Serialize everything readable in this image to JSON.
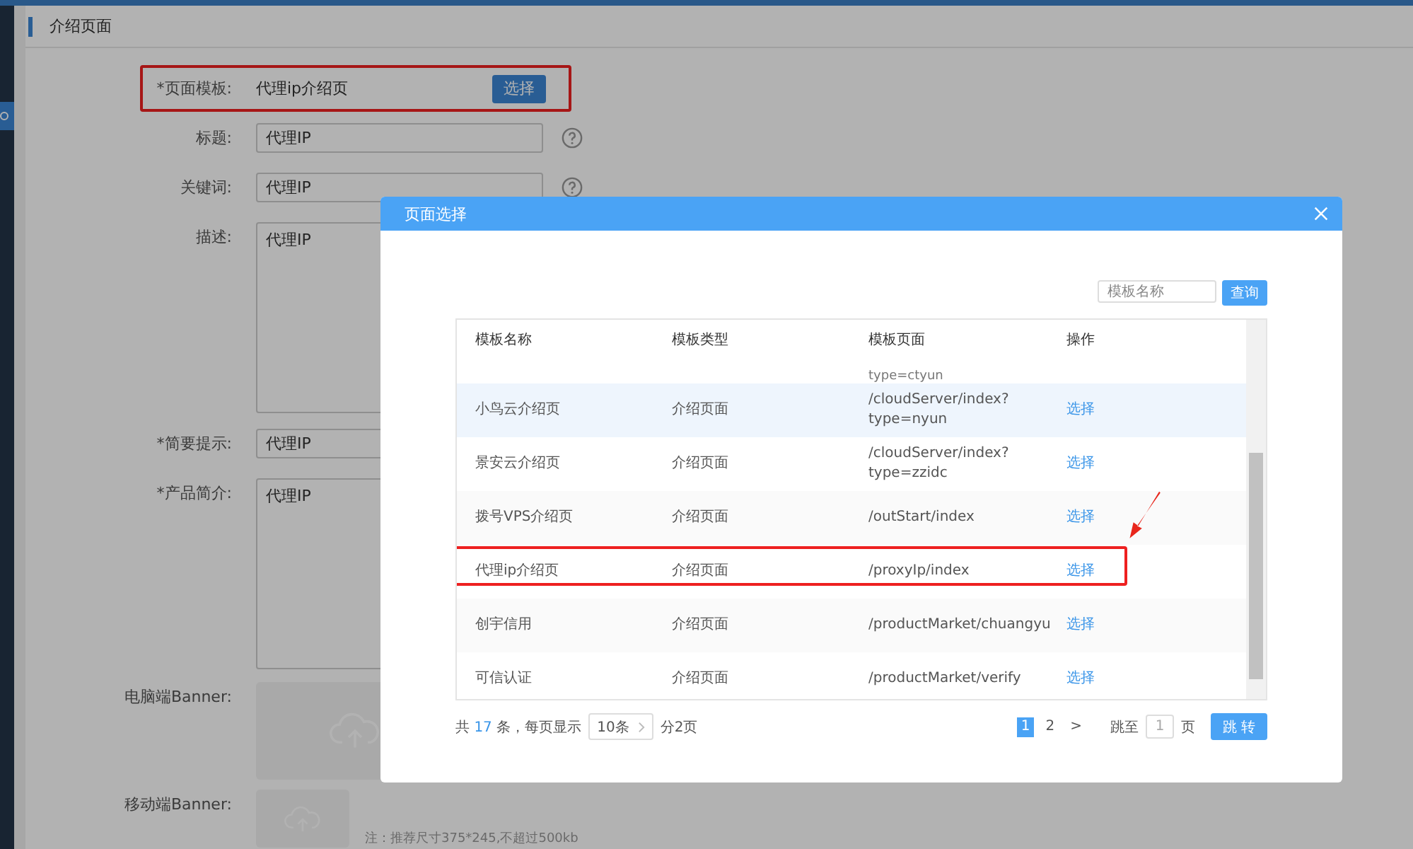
{
  "page": {
    "title": "介绍页面"
  },
  "form": {
    "fields": [
      {
        "kind": "static",
        "label": "*页面模板:",
        "annotated": true,
        "value": "代理ip介绍页",
        "button": "选择"
      },
      {
        "kind": "input",
        "label": "标题:",
        "help": true,
        "value": "代理IP"
      },
      {
        "kind": "input",
        "label": "关键词:",
        "help": true,
        "value": "代理IP"
      },
      {
        "kind": "textarea",
        "label": "描述:",
        "value": "代理IP"
      },
      {
        "kind": "input",
        "label": "*简要提示:",
        "help": false,
        "value": "代理IP"
      },
      {
        "kind": "textarea",
        "label": "*产品简介:",
        "value": "代理IP"
      },
      {
        "kind": "banner",
        "label": "电脑端Banner:"
      },
      {
        "kind": "thumb",
        "label": "移动端Banner:",
        "note": "注：推荐尺寸375*245,不超过500kb"
      }
    ]
  },
  "modal": {
    "title": "页面选择",
    "search": {
      "placeholder": "模板名称"
    },
    "search_button": "查询",
    "columns": [
      "模板名称",
      "模板类型",
      "模板页面",
      "操作"
    ],
    "rows": [
      {
        "kind": "cut",
        "page": "type=ctyun"
      },
      {
        "kind": "row",
        "name": "小鸟云介绍页",
        "type": "介绍页面",
        "page": "/cloudServer/index?\ntype=nyun",
        "action": "选择",
        "hovered": true,
        "annotated": false
      },
      {
        "kind": "row",
        "name": "景安云介绍页",
        "type": "介绍页面",
        "page": "/cloudServer/index?\ntype=zzidc",
        "action": "选择",
        "hovered": false,
        "annotated": false
      },
      {
        "kind": "row",
        "name": "拨号VPS介绍页",
        "type": "介绍页面",
        "page": "/outStart/index",
        "action": "选择",
        "hovered": false,
        "annotated": false
      },
      {
        "kind": "row",
        "name": "代理ip介绍页",
        "type": "介绍页面",
        "page": "/proxyIp/index",
        "action": "选择",
        "hovered": false,
        "annotated": true
      },
      {
        "kind": "row",
        "name": "创宇信用",
        "type": "介绍页面",
        "page": "/productMarket/chuangyu",
        "action": "选择",
        "hovered": false,
        "annotated": false
      },
      {
        "kind": "row",
        "name": "可信认证",
        "type": "介绍页面",
        "page": "/productMarket/verify",
        "action": "选择",
        "hovered": false,
        "annotated": false
      }
    ],
    "pagination": {
      "total_prefix": "共",
      "total": "17",
      "total_suffix": "条，每页显示",
      "page_size": "10条",
      "page_count": "分2页",
      "pages": [
        {
          "label": "1",
          "selected": true
        },
        {
          "label": "2",
          "selected": false
        }
      ],
      "next": ">",
      "jump_label": "跳至",
      "jump_value": "1",
      "jump_unit": "页",
      "jump_button": "跳 转"
    }
  }
}
